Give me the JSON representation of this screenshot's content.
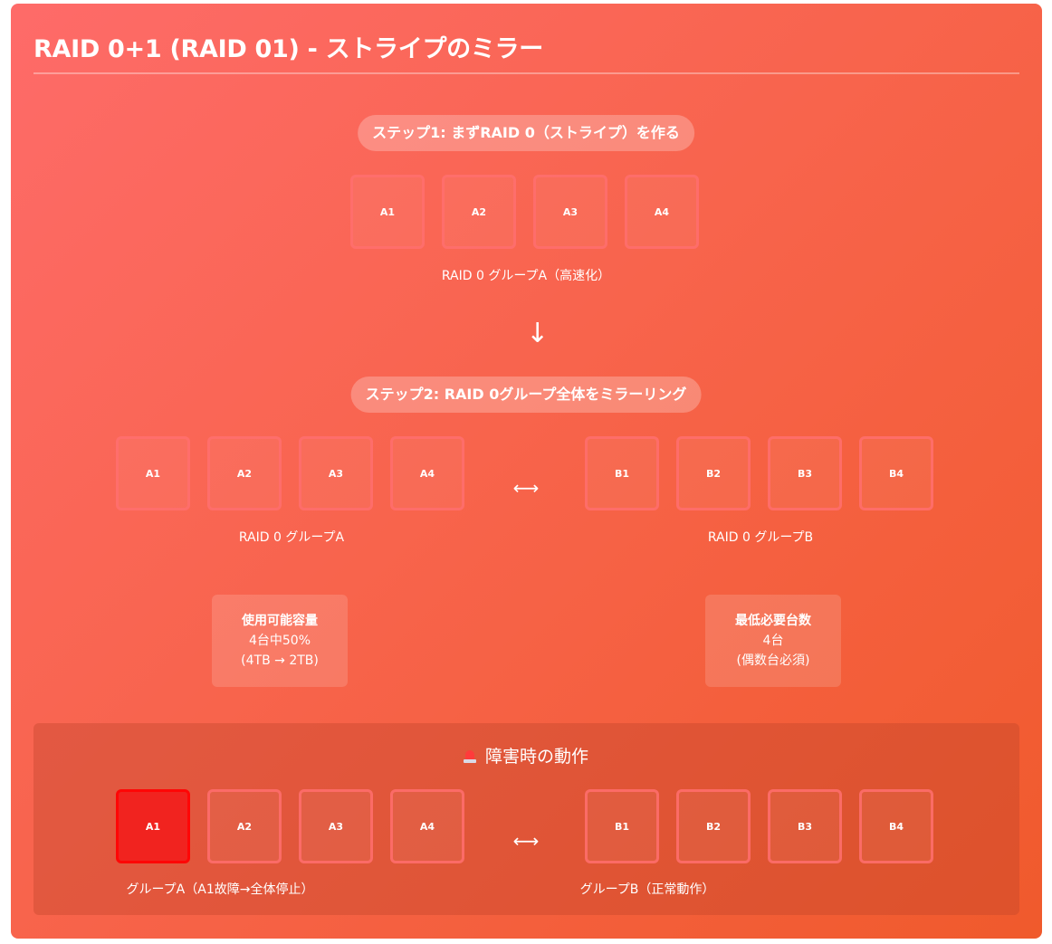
{
  "title": "RAID 0+1 (RAID 01) - ストライプのミラー",
  "step1": {
    "label": "ステップ1: まずRAID 0（ストライプ）を作る",
    "disks": [
      "A1",
      "A2",
      "A3",
      "A4"
    ],
    "group_label": "RAID 0 グループA（高速化）"
  },
  "arrow_down": "↓",
  "step2": {
    "label": "ステップ2: RAID 0グループ全体をミラーリング",
    "group_a": {
      "disks": [
        "A1",
        "A2",
        "A3",
        "A4"
      ],
      "label": "RAID 0 グループA"
    },
    "mirror_symbol": "⟷",
    "group_b": {
      "disks": [
        "B1",
        "B2",
        "B3",
        "B4"
      ],
      "label": "RAID 0 グループB"
    }
  },
  "info": {
    "capacity": {
      "heading": "使用可能容量",
      "line1": "4台中50%",
      "line2": "(4TB → 2TB)"
    },
    "minimum": {
      "heading": "最低必要台数",
      "line1": "4台",
      "line2": "(偶数台必須)"
    }
  },
  "failure": {
    "icon": "rotating-light-icon",
    "title": "障害時の動作",
    "group_a": {
      "disks": [
        "A1",
        "A2",
        "A3",
        "A4"
      ],
      "failed_disk": "A1",
      "label": "グループA（A1故障→全体停止）"
    },
    "mirror_symbol": "⟷",
    "group_b": {
      "disks": [
        "B1",
        "B2",
        "B3",
        "B4"
      ],
      "label": "グループB（正常動作）"
    }
  },
  "colors": {
    "background_start": "#fe6b69",
    "background_end": "#f05a2c",
    "disk_border": "#ff6e6e",
    "failed_disk": "#f1231f"
  }
}
